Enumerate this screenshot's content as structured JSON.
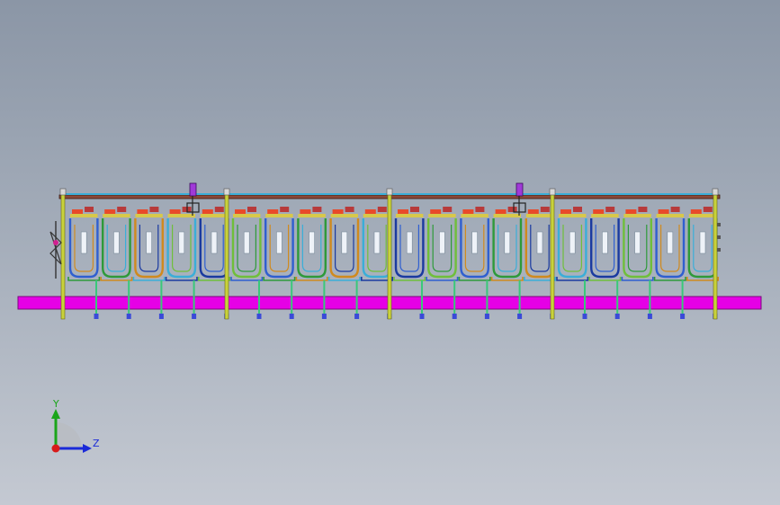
{
  "viewport": {
    "background_top": "#8b96a6",
    "background_bottom": "#c4c9d2"
  },
  "model": {
    "description_icon": "cad-assembly-side-view",
    "colors": {
      "base_plate": "#e600e6",
      "frame_rail": "#8a4a3a",
      "link_bar": "#3aaed8",
      "post": "#c8d23c",
      "valve": "#d02090",
      "cups": [
        "#2f5fd0",
        "#2e9a3a",
        "#d08a1e",
        "#3aaed8",
        "#1a3aa0",
        "#6fbf3a"
      ],
      "heads": [
        "#e84a2a",
        "#d8c84a",
        "#b83a3a"
      ],
      "leg": "#3ac87a",
      "foot": "#3a4ad8"
    }
  },
  "triad": {
    "y_label": "Y",
    "z_label": "Z",
    "y_color": "#1aa51a",
    "z_color": "#1a2ad8",
    "x_color": "#d81a1a"
  }
}
